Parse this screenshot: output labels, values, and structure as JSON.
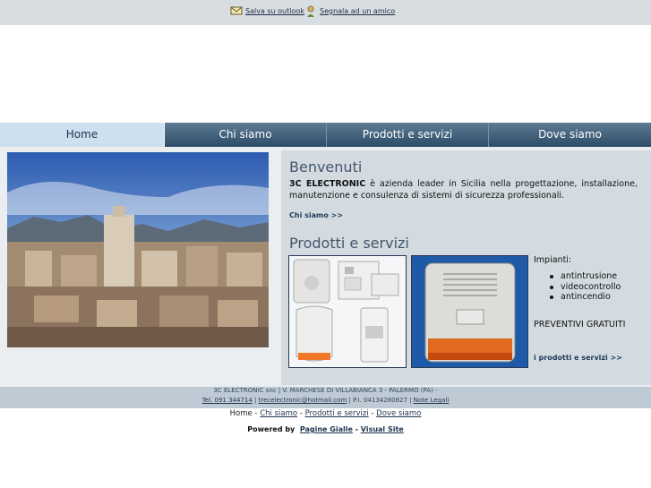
{
  "topbar": {
    "save_outlook": "Salva su outlook",
    "recommend": "Segnala ad un amico",
    "save_icon": "envelope-icon",
    "recommend_icon": "people-icon"
  },
  "nav": {
    "items": [
      "Home",
      "Chi siamo",
      "Prodotti e servizi",
      "Dove siamo"
    ],
    "active": "Home"
  },
  "welcome": {
    "title": "Benvenuti",
    "company": "3C ELECTRONIC",
    "text": " è azienda leader in Sicilia nella progettazione, installazione, manutenzione e consulenza di sistemi di sicurezza professionali.",
    "more": "Chi siamo >>"
  },
  "products": {
    "title": "Prodotti e servizi",
    "impianti_label": "Impianti:",
    "items": [
      "antintrusione",
      "videocontrollo",
      "antincendio"
    ],
    "offer": "PREVENTIVI GRATUITI",
    "more": "i prodotti e servizi >>"
  },
  "footer": {
    "line1": "3C ELECTRONIC snc | V. MARCHESE DI VILLABIANCA 3 - PALERMO (PA) -",
    "phone": "Tel. 091 344714",
    "email": "trecelectronic@hotmail.com",
    "vat": "P.I. 04134280827",
    "legal": "Note Legali",
    "sep": " | ",
    "nav": [
      "Home",
      "Chi siamo",
      "Prodotti e servizi",
      "Dove siamo"
    ],
    "nav_sep": " - ",
    "powered_label": "Powered by",
    "pagine": "Pagine Gialle",
    "dash": " - ",
    "visual": "Visual Site"
  },
  "colors": {
    "nav_dark": "#2c4c68",
    "nav_active": "#cde0ef",
    "content_bg": "#d3dbe0"
  }
}
